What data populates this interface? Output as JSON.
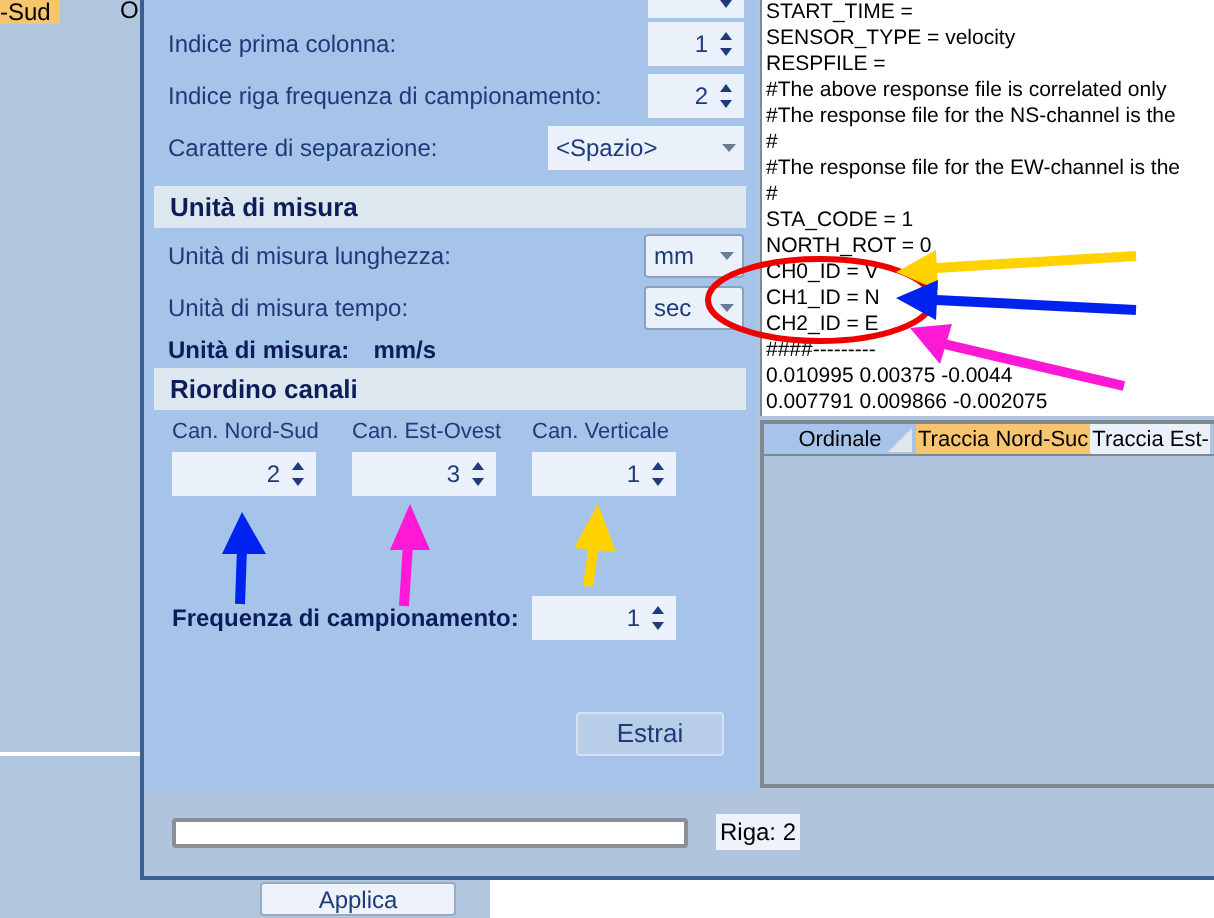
{
  "background_window": {
    "tab": "-Sud",
    "tab_2": "O",
    "button": "Applica"
  },
  "fields": [
    {
      "kind": "spinner"
    },
    {
      "kind": "spinner",
      "label": "Indice prima colonna:",
      "value": "1"
    },
    {
      "kind": "spinner",
      "label": "Indice riga frequenza di campionamento:",
      "value": "2"
    },
    {
      "kind": "flat-dropdown",
      "label": "Carattere di separazione:",
      "value": "<Spazio>"
    }
  ],
  "units": {
    "title": "Unità di misura",
    "fields": [
      {
        "label": "Unità di misura lunghezza:",
        "value": "mm"
      },
      {
        "label": "Unità di misura tempo:",
        "value": "sec"
      }
    ],
    "summary_label": "Unità di misura:",
    "summary_value": "mm/s"
  },
  "channels": {
    "title": "Riordino canali",
    "items": [
      {
        "label": "Can. Nord-Sud",
        "value": "2"
      },
      {
        "label": "Can. Est-Ovest",
        "value": "3"
      },
      {
        "label": "Can. Verticale",
        "value": "1"
      }
    ],
    "frequency_label": "Frequenza di campionamento:",
    "frequency_value": "1"
  },
  "extract_button": "Estrai",
  "text_lines": [
    "START_TIME =",
    "SENSOR_TYPE = velocity",
    "RESPFILE =",
    "#The above response file is correlated only",
    "#The response file for the NS-channel is the",
    "#",
    "#The response file for the EW-channel is the",
    "#",
    "STA_CODE = 1",
    "NORTH_ROT = 0",
    "CH0_ID = V",
    "CH1_ID = N",
    "CH2_ID = E",
    "####---------",
    "0.010995 0.00375 -0.0044",
    "0.007791 0.009866 -0.002075"
  ],
  "grid": {
    "columns": [
      {
        "label": "Ordinale",
        "selected": false
      },
      {
        "label": "Traccia Nord-Suc",
        "selected": true
      },
      {
        "label": "Traccia Est-",
        "selected": false
      }
    ]
  },
  "status": {
    "progress": {
      "level": 0
    },
    "row_label": "Riga: 2"
  }
}
